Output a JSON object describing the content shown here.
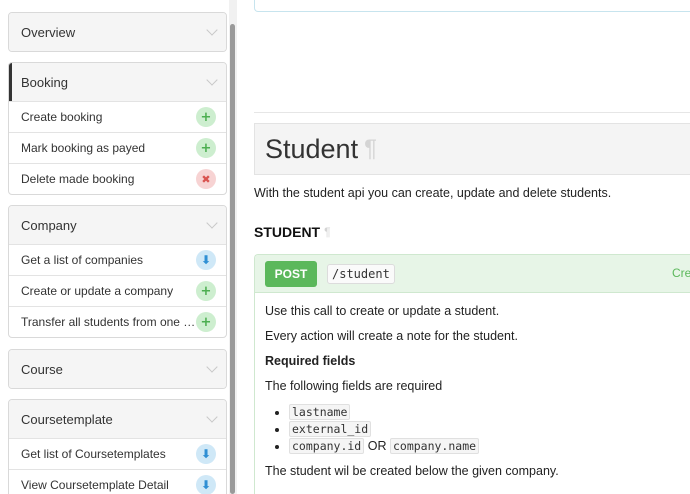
{
  "sidebar": {
    "groups": [
      {
        "title": "Overview",
        "items": []
      },
      {
        "title": "Booking",
        "items": [
          {
            "label": "Create booking",
            "icon": "plus-icon",
            "symbol": "+",
            "color": "green"
          },
          {
            "label": "Mark booking as payed",
            "icon": "plus-icon",
            "symbol": "+",
            "color": "green"
          },
          {
            "label": "Delete made booking",
            "icon": "close-icon",
            "symbol": "✖",
            "color": "red"
          }
        ]
      },
      {
        "title": "Company",
        "items": [
          {
            "label": "Get a list of companies",
            "icon": "arrow-down-icon",
            "symbol": "⬇",
            "color": "blue"
          },
          {
            "label": "Create or update a company",
            "icon": "plus-icon",
            "symbol": "+",
            "color": "green"
          },
          {
            "label": "Transfer all students from one company to another",
            "icon": "plus-icon",
            "symbol": "+",
            "color": "green"
          }
        ]
      },
      {
        "title": "Course",
        "items": []
      },
      {
        "title": "Coursetemplate",
        "items": [
          {
            "label": "Get list of Coursetemplates",
            "icon": "arrow-down-icon",
            "symbol": "⬇",
            "color": "blue"
          },
          {
            "label": "View Coursetemplate Detail",
            "icon": "arrow-down-icon",
            "symbol": "⬇",
            "color": "blue"
          }
        ]
      }
    ]
  },
  "main": {
    "title": "Student",
    "pilcrow": "¶",
    "intro": "With the student api you can create, update and delete students.",
    "section_title": "STUDENT",
    "endpoint": {
      "method": "POST",
      "path": "/student",
      "summary": "Create or update a student",
      "lines": [
        "Use this call to create or update a student.",
        "Every action will create a note for the student."
      ],
      "required_heading": "Required fields",
      "required_intro": "The following fields are required",
      "fields": [
        "lastname",
        "external_id"
      ],
      "alt_field_a": "company.id",
      "alt_or": "OR",
      "alt_field_b": "company.name",
      "footer": "The student wil be created below the given company."
    }
  },
  "colors": {
    "post": "#5cb85c",
    "post_bg": "#e7f5e7",
    "add_badge": "#4cae50",
    "delete_badge": "#d9534f",
    "get_badge": "#2f8fd4"
  }
}
